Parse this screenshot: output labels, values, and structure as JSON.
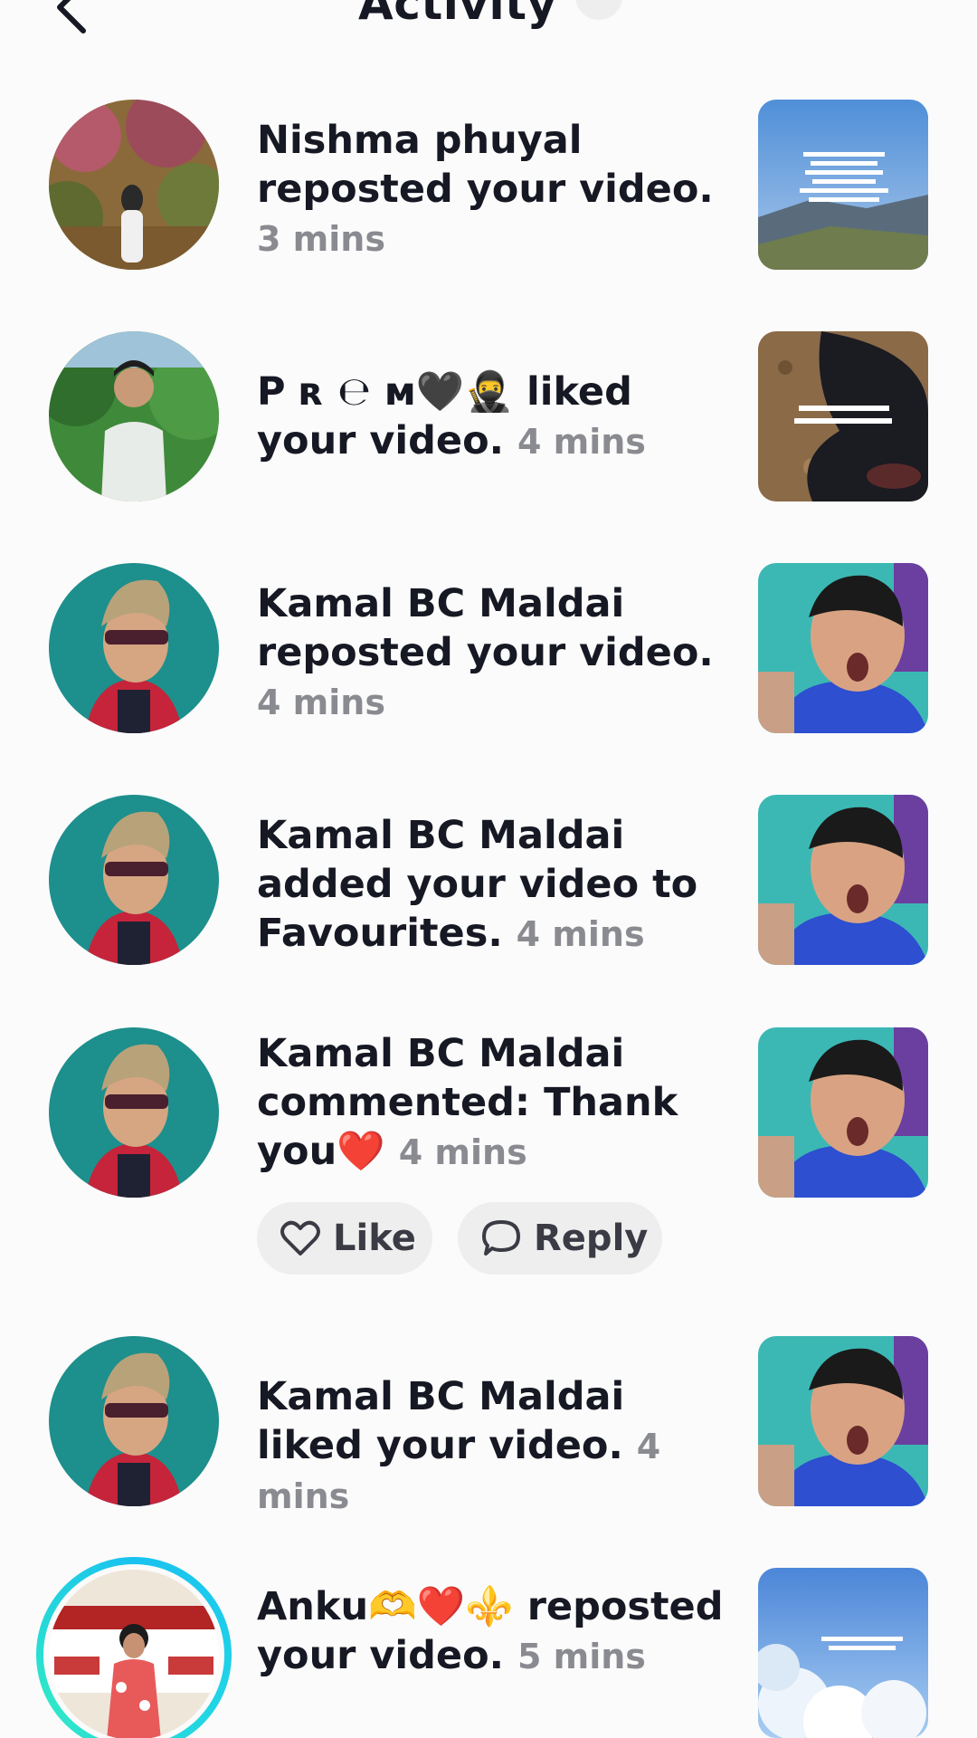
{
  "header": {
    "title": "Activity"
  },
  "notifications": [
    {
      "name": "Nishma phuyal",
      "action": " reposted your video.",
      "time": "3 mins"
    },
    {
      "name": "P ʀ ℮ ᴍ🖤🥷",
      "action": " liked your video.",
      "time": "4 mins"
    },
    {
      "name": "Kamal BC Maldai",
      "action": " reposted your video.",
      "time": "4 mins"
    },
    {
      "name": "Kamal BC Maldai",
      "action": " added your video to Favourites.",
      "time": "4 mins"
    },
    {
      "name": "Kamal BC Maldai",
      "action": " commented: Thank you❤️",
      "time": "4 mins"
    },
    {
      "name": "Kamal BC Maldai",
      "action": " liked your video.",
      "time": "4 mins"
    },
    {
      "name": "Anku🫶❤️⚜️",
      "action": " reposted your video.",
      "time": "5 mins"
    }
  ],
  "comment_actions": {
    "like_label": "Like",
    "reply_label": "Reply"
  },
  "colors": {
    "text": "#161823",
    "secondary": "#8a8b91",
    "chip_bg": "#eeeeee",
    "story_ring": "#20d4e6"
  }
}
